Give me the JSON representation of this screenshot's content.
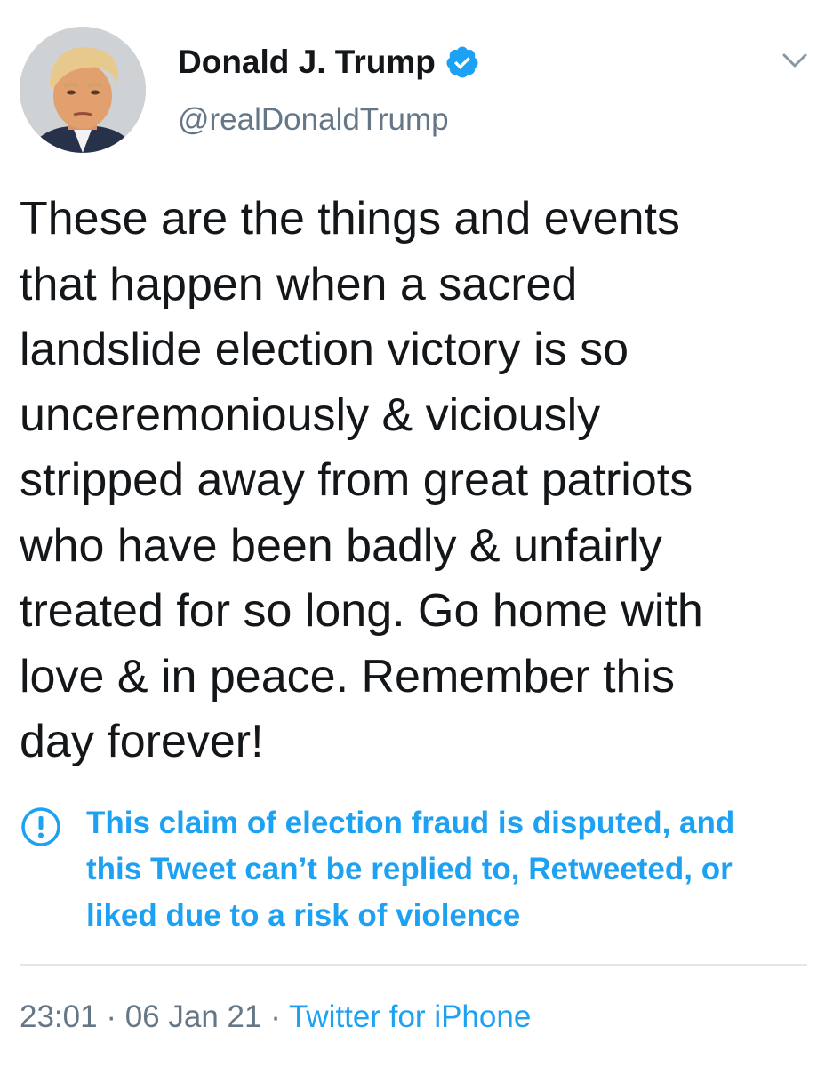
{
  "tweet": {
    "author": {
      "display_name": "Donald J. Trump",
      "handle": "@realDonaldTrump",
      "verified": true
    },
    "text": "These are the things and events\nthat happen when a sacred\nlandslide election victory is so\nunceremoniously & viciously\nstripped away from great patriots\nwho have been badly & unfairly\ntreated for so long. Go home with\nlove & in peace. Remember this\nday forever!",
    "notice": "This claim of election fraud is disputed, and\nthis Tweet can’t be replied to, Retweeted, or\nliked due to a risk of violence",
    "time": "23:01",
    "date": "06 Jan 21",
    "separator": "·",
    "source": "Twitter for iPhone"
  },
  "colors": {
    "accent": "#1da1f2",
    "secondary_text": "#657786",
    "divider": "#e1e8ed"
  },
  "icons": {
    "verified": "verified-badge-icon",
    "menu": "chevron-down-icon",
    "notice": "exclamation-circle-icon"
  }
}
